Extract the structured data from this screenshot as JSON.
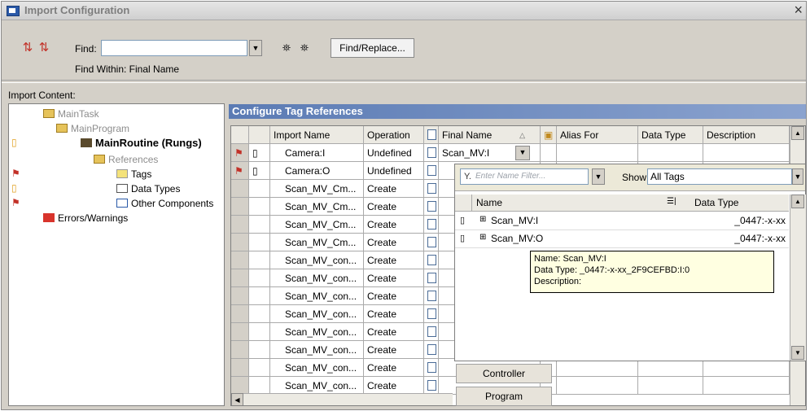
{
  "window": {
    "title": "Import Configuration",
    "close_glyph": "×"
  },
  "toolbar": {
    "find_label": "Find:",
    "find_value": "",
    "find_within": "Find Within: Final Name",
    "find_replace_label": "Find/Replace..."
  },
  "import_content": {
    "label": "Import Content:",
    "tree": [
      {
        "label": "MainTask",
        "style": "gray"
      },
      {
        "label": "MainProgram",
        "style": "gray"
      },
      {
        "label": "MainRoutine (Rungs)",
        "style": "bold"
      },
      {
        "label": "References",
        "style": "gray"
      },
      {
        "label": "Tags",
        "style": "normal"
      },
      {
        "label": "Data Types",
        "style": "normal"
      },
      {
        "label": "Other Components",
        "style": "normal"
      },
      {
        "label": "Errors/Warnings",
        "style": "normal"
      }
    ]
  },
  "configure": {
    "header": "Configure Tag References",
    "columns": [
      "Import Name",
      "Operation",
      "Final Name",
      "Alias For",
      "Data Type",
      "Description"
    ],
    "rows": [
      {
        "import_name": "Camera:I",
        "operation": "Undefined",
        "final_name": "Scan_MV:I"
      },
      {
        "import_name": "Camera:O",
        "operation": "Undefined",
        "final_name": ""
      },
      {
        "import_name": "Scan_MV_Cm...",
        "operation": "Create",
        "final_name": ""
      },
      {
        "import_name": "Scan_MV_Cm...",
        "operation": "Create",
        "final_name": ""
      },
      {
        "import_name": "Scan_MV_Cm...",
        "operation": "Create",
        "final_name": ""
      },
      {
        "import_name": "Scan_MV_Cm...",
        "operation": "Create",
        "final_name": ""
      },
      {
        "import_name": "Scan_MV_con...",
        "operation": "Create",
        "final_name": ""
      },
      {
        "import_name": "Scan_MV_con...",
        "operation": "Create",
        "final_name": ""
      },
      {
        "import_name": "Scan_MV_con...",
        "operation": "Create",
        "final_name": ""
      },
      {
        "import_name": "Scan_MV_con...",
        "operation": "Create",
        "final_name": ""
      },
      {
        "import_name": "Scan_MV_con...",
        "operation": "Create",
        "final_name": ""
      },
      {
        "import_name": "Scan_MV_con...",
        "operation": "Create",
        "final_name": ""
      },
      {
        "import_name": "Scan_MV_con...",
        "operation": "Create",
        "final_name": ""
      },
      {
        "import_name": "Scan_MV_con...",
        "operation": "Create",
        "final_name": ""
      }
    ]
  },
  "tag_browser": {
    "filter_placeholder": "Enter Name Filter...",
    "show_label": "Show:",
    "show_value": "All Tags",
    "columns": [
      "Name",
      "Data Type"
    ],
    "items": [
      {
        "name": "Scan_MV:I",
        "data_type": "_0447:-x-xx"
      },
      {
        "name": "Scan_MV:O",
        "data_type": "_0447:-x-xx"
      }
    ],
    "tooltip": {
      "name": "Name: Scan_MV:I",
      "data_type": "Data Type: _0447:-x-xx_2F9CEFBD:I:0",
      "description": "Description:"
    },
    "buttons": [
      "Controller",
      "Program"
    ]
  }
}
